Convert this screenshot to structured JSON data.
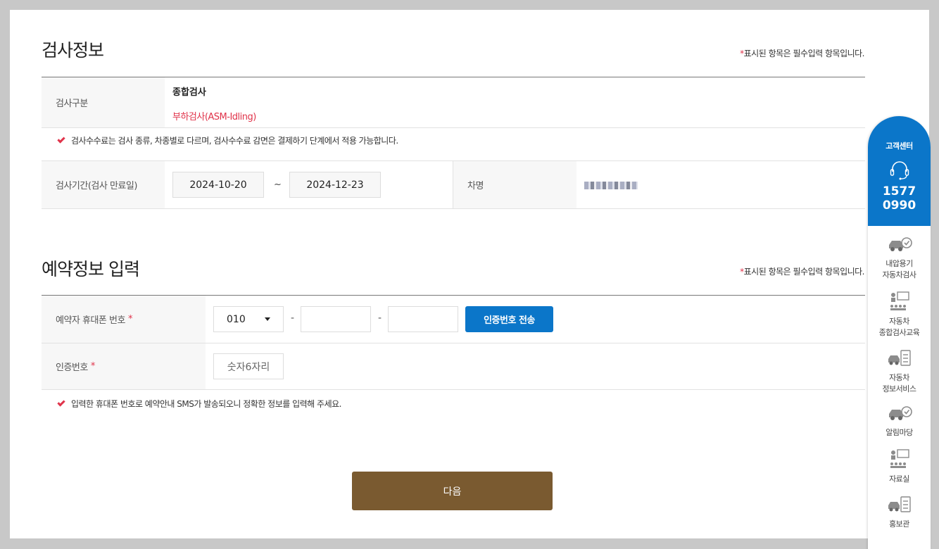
{
  "inspection": {
    "title": "검사정보",
    "required_note_star": "*",
    "required_note": "표시된 항목은 필수입력 항목입니다.",
    "type_label": "검사구분",
    "type_main": "종합검사",
    "type_sub": "부하검사(ASM-Idling)",
    "fee_notice": "검사수수료는 검사 종류, 차종별로 다르며, 검사수수료 감면은 결제하기 단계에서 적용 가능합니다.",
    "period_label": "검사기간(검사 만료일)",
    "period_start": "2024-10-20",
    "period_sep": "~",
    "period_end": "2024-12-23",
    "car_name_label": "차명"
  },
  "reservation": {
    "title": "예약정보 입력",
    "required_note_star": "*",
    "required_note": "표시된 항목은 필수입력 항목입니다.",
    "phone_label": "예약자 휴대폰 번호",
    "required_star": "*",
    "phone_prefix": "010",
    "phone_dash": "-",
    "phone_middle": "",
    "phone_last": "",
    "send_code_button": "인증번호 전송",
    "code_label": "인증번호",
    "code_placeholder": "숫자6자리",
    "sms_notice": "입력한 휴대폰 번호로 예약안내 SMS가 발송되오니 정확한 정보를 입력해 주세요."
  },
  "next_button": "다음",
  "quick_menu": {
    "title": "고객센터",
    "phone_line1": "1577",
    "phone_line2": "0990",
    "items": [
      {
        "line1": "내압용기",
        "line2": "자동차검사",
        "icon": "car-check-icon"
      },
      {
        "line1": "자동차",
        "line2": "종합검사교육",
        "icon": "education-icon"
      },
      {
        "line1": "자동차",
        "line2": "정보서비스",
        "icon": "info-service-icon"
      },
      {
        "line1": "알림마당",
        "line2": "",
        "icon": "car-check-icon"
      },
      {
        "line1": "자료실",
        "line2": "",
        "icon": "education-icon"
      },
      {
        "line1": "홍보관",
        "line2": "",
        "icon": "info-service-icon"
      }
    ]
  },
  "colors": {
    "accent_blue": "#0b76c9",
    "next_button_brown": "#7a5a30",
    "required_red": "#e0334a"
  }
}
